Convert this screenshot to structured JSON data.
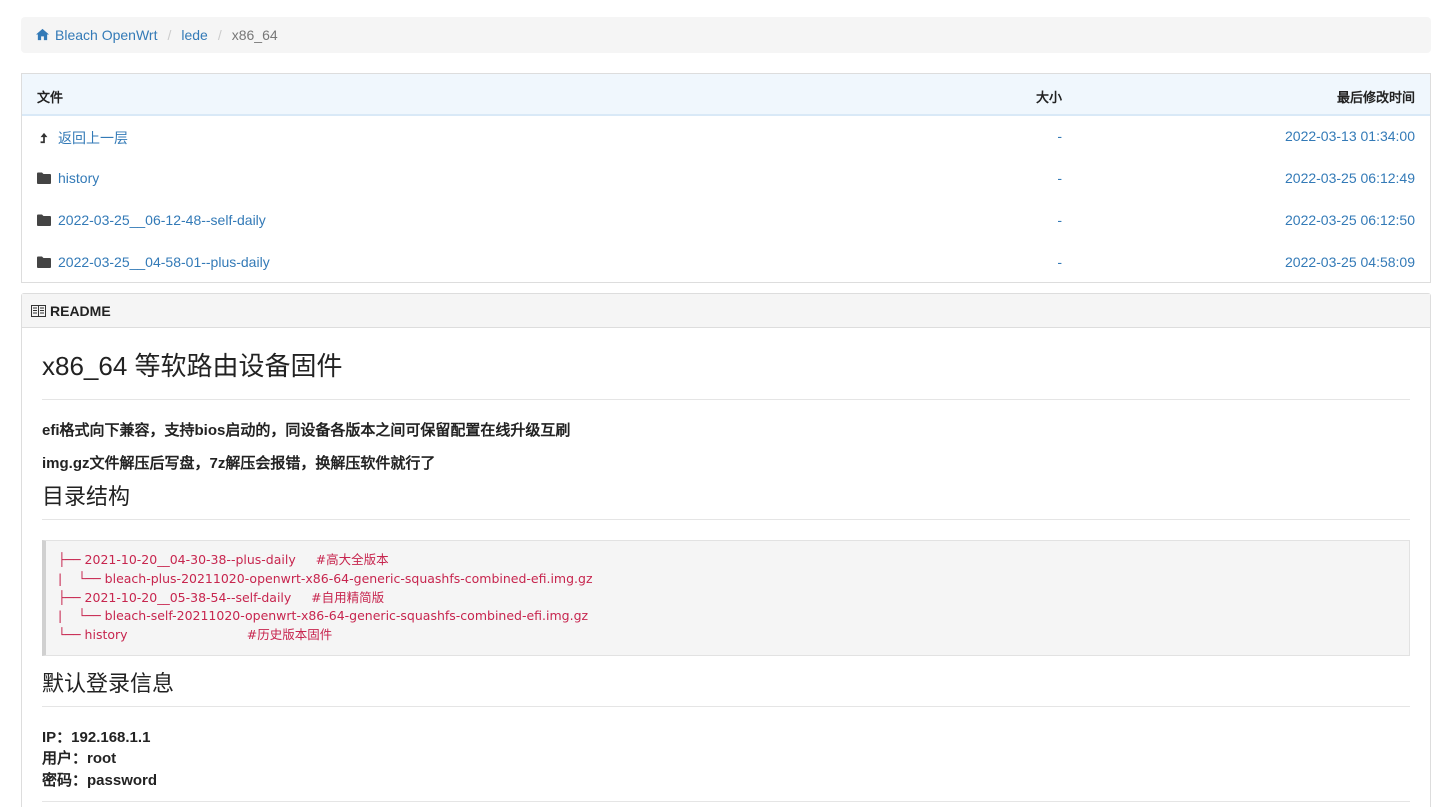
{
  "breadcrumb": {
    "home_label": "Bleach OpenWrt",
    "level2": "lede",
    "current": "x86_64"
  },
  "files": {
    "columns": {
      "name": "文件",
      "size": "大小",
      "modified": "最后修改时间"
    },
    "rows": [
      {
        "icon": "level-up-icon",
        "name": "返回上一层",
        "size": "-",
        "modified": "2022-03-13 01:34:00"
      },
      {
        "icon": "folder-icon",
        "name": "history",
        "size": "-",
        "modified": "2022-03-25 06:12:49"
      },
      {
        "icon": "folder-icon",
        "name": "2022-03-25__06-12-48--self-daily",
        "size": "-",
        "modified": "2022-03-25 06:12:50"
      },
      {
        "icon": "folder-icon",
        "name": "2022-03-25__04-58-01--plus-daily",
        "size": "-",
        "modified": "2022-03-25 04:58:09"
      }
    ]
  },
  "readme": {
    "header": "README",
    "title": "x86_64 等软路由设备固件",
    "para1": "efi格式向下兼容，支持bios启动的，同设备各版本之间可保留配置在线升级互刷",
    "para2": "img.gz文件解压后写盘，7z解压会报错，换解压软件就行了",
    "section_tree": "目录结构",
    "tree_lines": [
      "├── 2021-10-20__04-30-38--plus-daily     #高大全版本",
      "|    └── bleach-plus-20211020-openwrt-x86-64-generic-squashfs-combined-efi.img.gz",
      "├── 2021-10-20__05-38-54--self-daily     #自用精简版",
      "|    └── bleach-self-20211020-openwrt-x86-64-generic-squashfs-combined-efi.img.gz",
      "└── history                              #历史版本固件"
    ],
    "section_login": "默认登录信息",
    "login_lines": [
      "IP：192.168.1.1",
      "用户：root",
      "密码：password"
    ]
  },
  "colors": {
    "link": "#337ab7",
    "code_text": "#c7254e",
    "header_bg": "#f0f7fd"
  }
}
